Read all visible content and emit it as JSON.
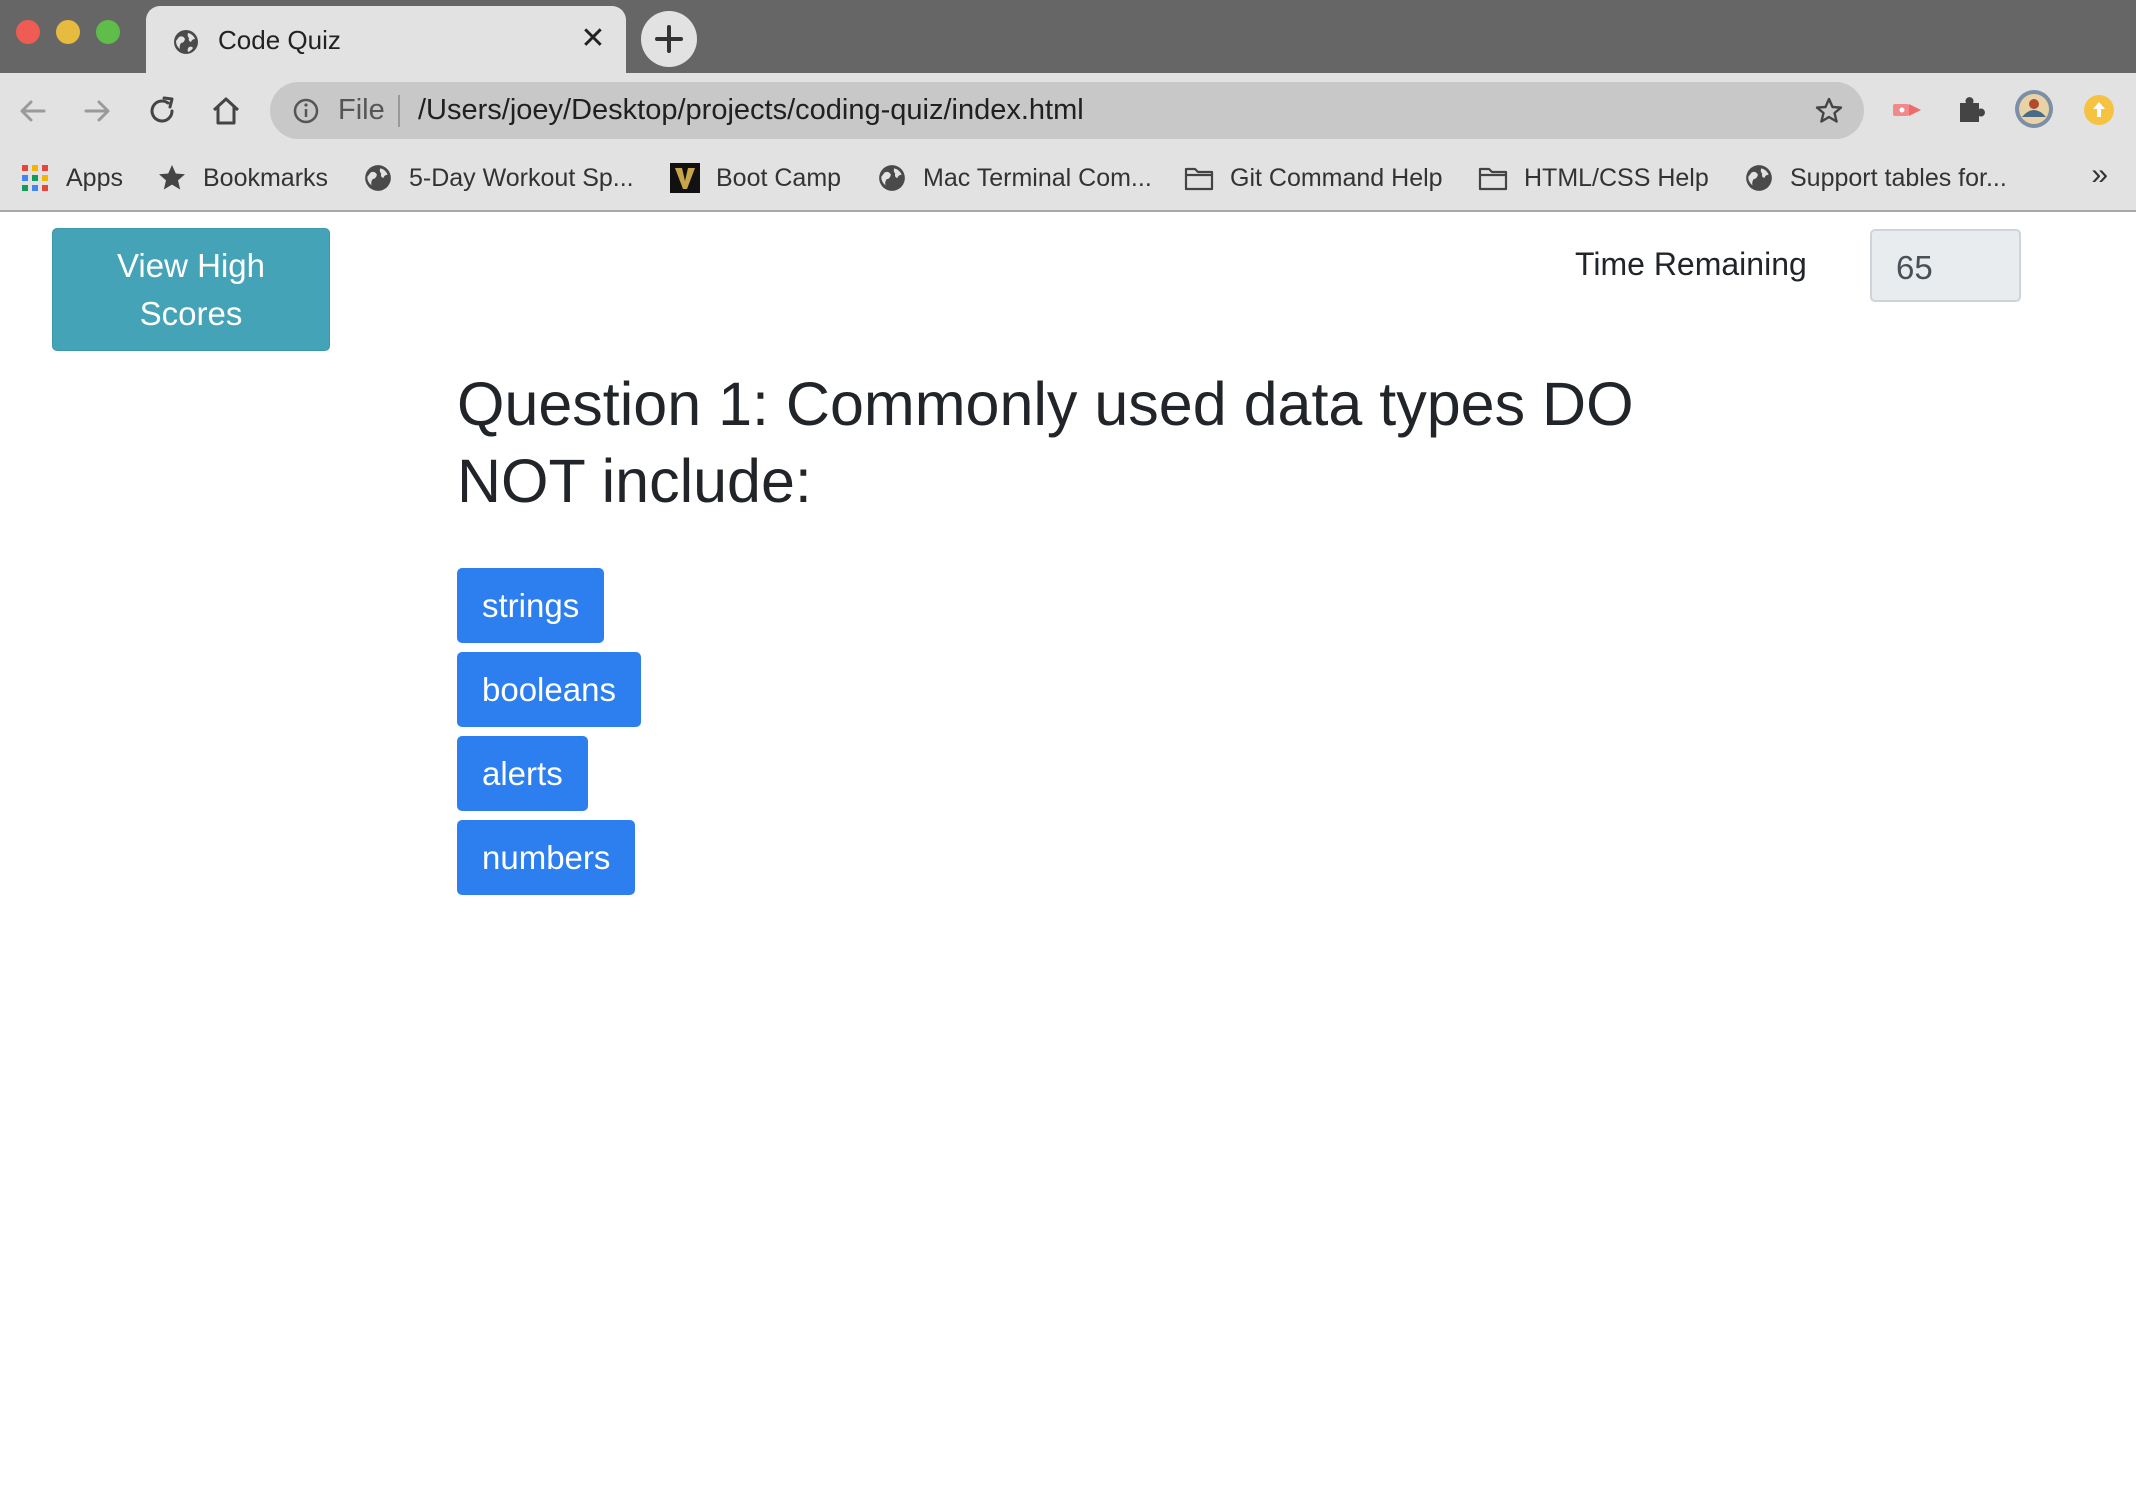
{
  "browser": {
    "tab_title": "Code Quiz",
    "tab_close": "✕",
    "new_tab": "+",
    "address_scheme": "File",
    "address_url": "/Users/joey/Desktop/projects/coding-quiz/index.html",
    "bookmarks": [
      {
        "label": "Apps",
        "icon": "apps-grid-icon"
      },
      {
        "label": "Bookmarks",
        "icon": "star-icon"
      },
      {
        "label": "5-Day Workout Sp...",
        "icon": "globe-icon"
      },
      {
        "label": "Boot Camp",
        "icon": "vanderbilt-v-icon"
      },
      {
        "label": "Mac Terminal Com...",
        "icon": "globe-icon"
      },
      {
        "label": "Git Command Help",
        "icon": "folder-icon"
      },
      {
        "label": "HTML/CSS Help",
        "icon": "folder-icon"
      },
      {
        "label": "Support tables for...",
        "icon": "globe-icon"
      }
    ],
    "bookmarks_overflow": "»"
  },
  "page": {
    "high_scores_label": "View High Scores",
    "time_label": "Time Remaining",
    "time_value": "65",
    "question": "Question 1: Commonly used data types DO NOT include:",
    "answers": [
      "strings",
      "booleans",
      "alerts",
      "numbers"
    ]
  },
  "colors": {
    "high_scores_button": "#45a3b8",
    "answer_button": "#2d7ff0",
    "titlebar": "#666666",
    "toolbar": "#e2e2e2"
  }
}
